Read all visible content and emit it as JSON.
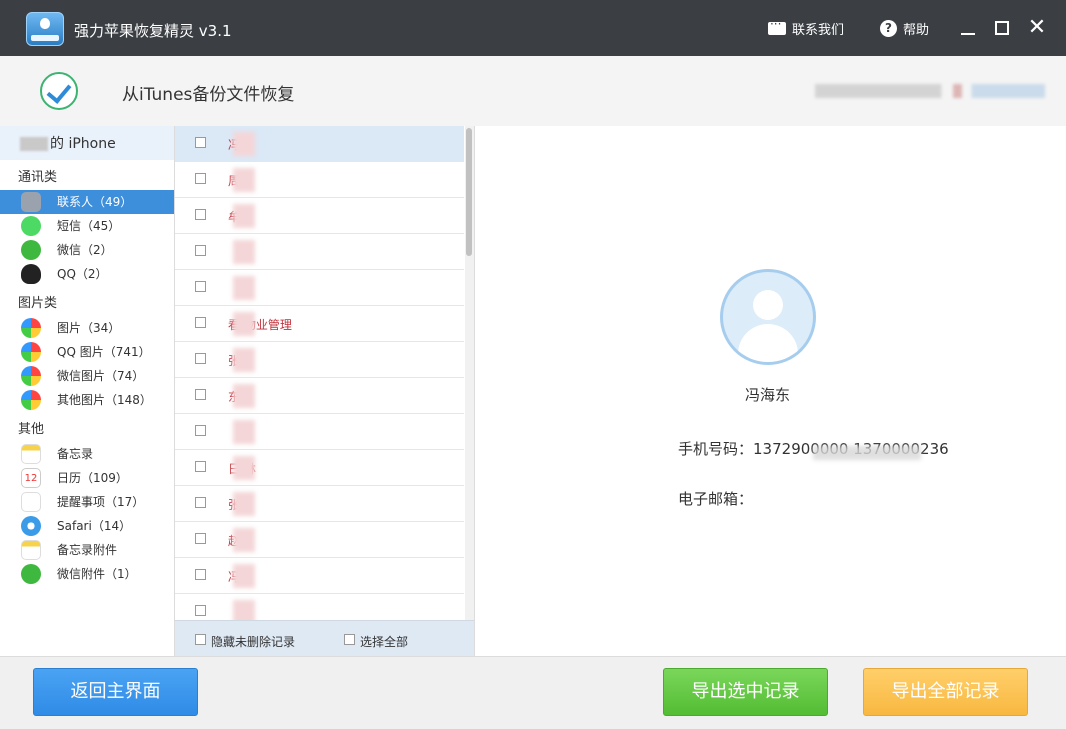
{
  "window": {
    "title": "强力苹果恢复精灵 v3.1",
    "contact_label": "联系我们",
    "help_label": "帮助",
    "minimize_icon": "minimize-icon",
    "maximize_icon": "maximize-icon",
    "close_glyph": "✕"
  },
  "header": {
    "title": "从iTunes备份文件恢复"
  },
  "sidebar": {
    "device": "的 iPhone",
    "sections": [
      {
        "label": "通讯类"
      },
      {
        "label": "图片类"
      },
      {
        "label": "其他"
      }
    ],
    "items": [
      {
        "label": "联系人（49）",
        "icon": "contacts-icon",
        "active": true
      },
      {
        "label": "短信（45）",
        "icon": "sms-icon"
      },
      {
        "label": "微信（2）",
        "icon": "wechat-icon"
      },
      {
        "label": "QQ（2）",
        "icon": "qq-icon"
      },
      {
        "label": "图片（34）",
        "icon": "photos-icon"
      },
      {
        "label": "QQ 图片（741）",
        "icon": "qq-photos-icon"
      },
      {
        "label": "微信图片（74）",
        "icon": "wechat-photos-icon"
      },
      {
        "label": "其他图片（148）",
        "icon": "other-photos-icon"
      },
      {
        "label": "备忘录",
        "icon": "notes-icon"
      },
      {
        "label": "日历（109）",
        "icon": "calendar-icon",
        "calendar_day": "12"
      },
      {
        "label": "提醒事项（17）",
        "icon": "reminders-icon"
      },
      {
        "label": "Safari（14）",
        "icon": "safari-icon"
      },
      {
        "label": "备忘录附件",
        "icon": "notes-attachment-icon"
      },
      {
        "label": "微信附件（1）",
        "icon": "wechat-attachment-icon"
      }
    ]
  },
  "list": {
    "rows": [
      {
        "name": "冯"
      },
      {
        "name": "周"
      },
      {
        "name": "牟"
      },
      {
        "name": ""
      },
      {
        "name": ""
      },
      {
        "name": "看  物业管理"
      },
      {
        "name": "张"
      },
      {
        "name": "东"
      },
      {
        "name": ""
      },
      {
        "name": "日  林"
      },
      {
        "name": "张"
      },
      {
        "name": "赵"
      },
      {
        "name": "冯"
      },
      {
        "name": ""
      }
    ],
    "hide_undeleted_label": "隐藏未删除记录",
    "select_all_label": "选择全部"
  },
  "detail": {
    "name": "冯海东",
    "phone_label": "手机号码：",
    "phone_value": "1372900000  1370000236",
    "email_label": "电子邮箱：",
    "email_value": ""
  },
  "bottom": {
    "back_label": "返回主界面",
    "export_selected_label": "导出选中记录",
    "export_all_label": "导出全部记录"
  },
  "colors": {
    "titlebar": "#3b3f44",
    "accent": "#3d8fdc",
    "export_selected": "#5fc63d",
    "export_all": "#f8bd4a"
  }
}
